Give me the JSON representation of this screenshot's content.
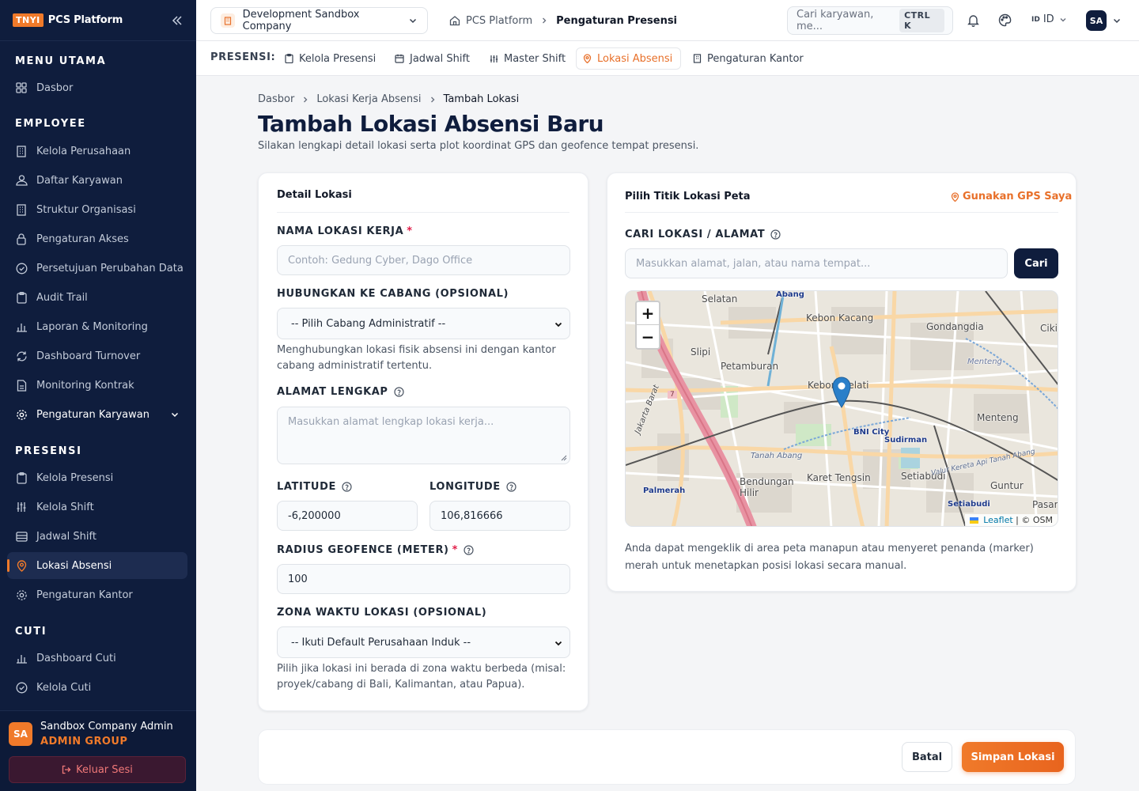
{
  "brand": {
    "badge": "TNYI",
    "name": "PCS Platform"
  },
  "sidebar": {
    "sections": [
      {
        "title": "MENU UTAMA",
        "items": [
          {
            "label": "Dasbor",
            "icon": "grid-icon"
          }
        ]
      },
      {
        "title": "EMPLOYEE",
        "items": [
          {
            "label": "Kelola Perusahaan",
            "icon": "building-icon"
          },
          {
            "label": "Daftar Karyawan",
            "icon": "users-icon"
          },
          {
            "label": "Struktur Organisasi",
            "icon": "building-icon"
          },
          {
            "label": "Pengaturan Akses",
            "icon": "lock-icon"
          },
          {
            "label": "Persetujuan Perubahan Data",
            "icon": "check-circle-icon"
          },
          {
            "label": "Audit Trail",
            "icon": "clipboard-icon"
          },
          {
            "label": "Laporan & Monitoring",
            "icon": "bar-chart-icon"
          },
          {
            "label": "Dashboard Turnover",
            "icon": "refresh-icon"
          },
          {
            "label": "Monitoring Kontrak",
            "icon": "file-icon"
          },
          {
            "label": "Pengaturan Karyawan",
            "icon": "gear-icon"
          }
        ]
      },
      {
        "title": "PRESENSI",
        "items": [
          {
            "label": "Kelola Presensi",
            "icon": "clipboard-icon"
          },
          {
            "label": "Kelola Shift",
            "icon": "sliders-icon"
          },
          {
            "label": "Jadwal Shift",
            "icon": "table-icon"
          },
          {
            "label": "Lokasi Absensi",
            "icon": "map-pin-icon"
          },
          {
            "label": "Pengaturan Kantor",
            "icon": "gear-icon"
          }
        ]
      },
      {
        "title": "CUTI",
        "items": [
          {
            "label": "Dashboard Cuti",
            "icon": "bar-chart-icon"
          },
          {
            "label": "Kelola Cuti",
            "icon": "check-circle-icon"
          }
        ]
      }
    ],
    "user": {
      "initials": "SA",
      "name": "Sandbox Company Admin",
      "role": "ADMIN GROUP"
    },
    "logout_label": "Keluar Sesi"
  },
  "topbar": {
    "company": "Development Sandbox Company",
    "breadcrumb": [
      "PCS Platform",
      "Pengaturan Presensi"
    ],
    "search_placeholder": "Cari karyawan, me...",
    "shortcut": "CTRL K",
    "lang_code": "ID",
    "lang_label": "ID",
    "avatar": "SA"
  },
  "subnav": {
    "label": "PRESENSI:",
    "items": [
      "Kelola Presensi",
      "Jadwal Shift",
      "Master Shift",
      "Lokasi Absensi",
      "Pengaturan Kantor"
    ],
    "active": "Lokasi Absensi"
  },
  "page": {
    "breadcrumb": [
      "Dasbor",
      "Lokasi Kerja Absensi",
      "Tambah Lokasi"
    ],
    "title": "Tambah Lokasi Absensi Baru",
    "subtitle": "Silakan lengkapi detail lokasi serta plot koordinat GPS dan geofence tempat presensi."
  },
  "form": {
    "card_title": "Detail Lokasi",
    "name_label": "NAMA LOKASI KERJA",
    "name_placeholder": "Contoh: Gedung Cyber, Dago Office",
    "branch_label": "HUBUNGKAN KE CABANG (OPSIONAL)",
    "branch_value": "-- Pilih Cabang Administratif --",
    "branch_hint": "Menghubungkan lokasi fisik absensi ini dengan kantor cabang administratif tertentu.",
    "address_label": "ALAMAT LENGKAP",
    "address_placeholder": "Masukkan alamat lengkap lokasi kerja...",
    "lat_label": "LATITUDE",
    "lat_value": "-6,200000",
    "lng_label": "LONGITUDE",
    "lng_value": "106,816666",
    "radius_label": "RADIUS GEOFENCE (METER)",
    "radius_value": "100",
    "tz_label": "ZONA WAKTU LOKASI (OPSIONAL)",
    "tz_value": "-- Ikuti Default Perusahaan Induk --",
    "tz_hint": "Pilih jika lokasi ini berada di zona waktu berbeda (misal: proyek/cabang di Bali, Kalimantan, atau Papua).",
    "required_mark": "*"
  },
  "map_card": {
    "title": "Pilih Titik Lokasi Peta",
    "gps_label": "Gunakan GPS Saya",
    "search_label": "CARI LOKASI / ALAMAT",
    "search_placeholder": "Masukkan alamat, jalan, atau nama tempat...",
    "search_button": "Cari",
    "zoom_in": "+",
    "zoom_out": "−",
    "attribution_leaflet": "Leaflet",
    "attribution_osm": "| © OSM",
    "hint": "Anda dapat mengeklik di area peta manapun atau menyeret penanda (marker) merah untuk menetapkan posisi lokasi secara manual.",
    "places": [
      "Selatan",
      "Abang",
      "Kebon Kacang",
      "Gondangdia",
      "Cikini",
      "Slipi",
      "Petamburan",
      "Kebon Melati",
      "Menteng",
      "Menteng",
      "BNI City",
      "Sudirman",
      "Tanah Abang",
      "Bendungan Hilir",
      "Karet Tengsin",
      "Setiabudi",
      "Guntur",
      "Palmerah",
      "Setiabudi",
      "Pasar",
      "Jakarta Barat",
      "Valur Kereta Api Tanah Abang",
      "7"
    ]
  },
  "actions": {
    "cancel": "Batal",
    "save": "Simpan Lokasi"
  },
  "colors": {
    "sidebar_bg": "#0f1d3d",
    "accent": "#f07a2a",
    "primary_button": "#0f1d3d",
    "required": "#e11d48"
  }
}
